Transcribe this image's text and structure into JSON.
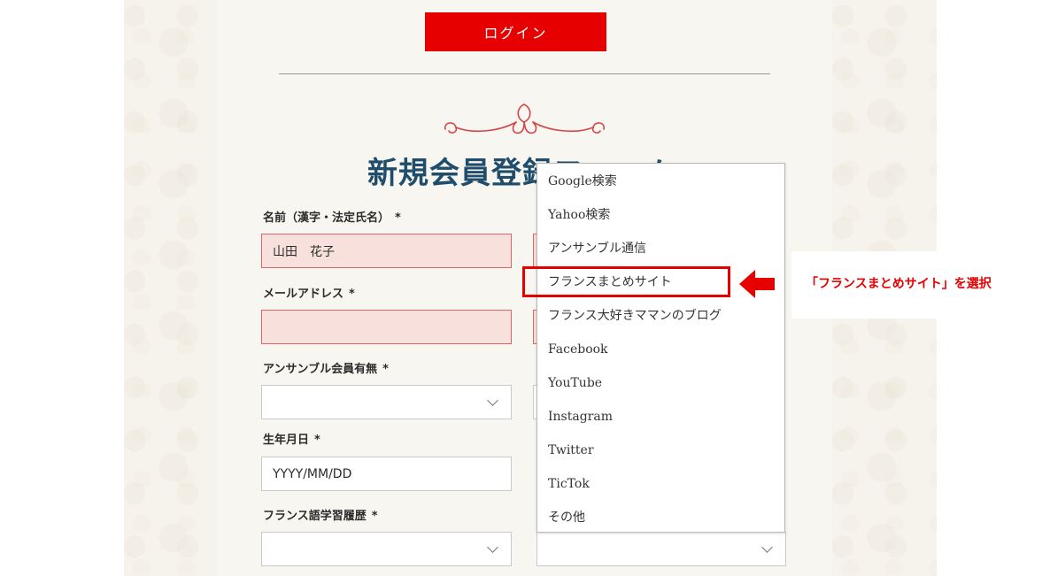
{
  "header": {
    "login_label": "ログイン"
  },
  "form": {
    "title": "新規会員登録フォーム",
    "required_mark": "*",
    "name": {
      "label": "名前（漢字・法定氏名）",
      "value": "山田　花子"
    },
    "email": {
      "label": "メールアドレス",
      "value": ""
    },
    "membership": {
      "label": "アンサンブル会員有無",
      "value": ""
    },
    "birthday": {
      "label": "生年月日",
      "placeholder": "YYYY/MM/DD"
    },
    "french_history": {
      "label": "フランス語学習履歴",
      "value": ""
    }
  },
  "dropdown": {
    "options": [
      "Google検索",
      "Yahoo検索",
      "アンサンブル通信",
      "フランスまとめサイト",
      "フランス大好きママンのブログ",
      "Facebook",
      "YouTube",
      "Instagram",
      "Twitter",
      "TicTok",
      "その他"
    ],
    "highlighted": "フランスまとめサイト"
  },
  "annotation": {
    "text": "「フランスまとめサイト」を選択"
  },
  "colors": {
    "accent": "#e60000",
    "title": "#1f4d6b",
    "error_bg": "#f8e1dc",
    "error_border": "#e06666"
  }
}
